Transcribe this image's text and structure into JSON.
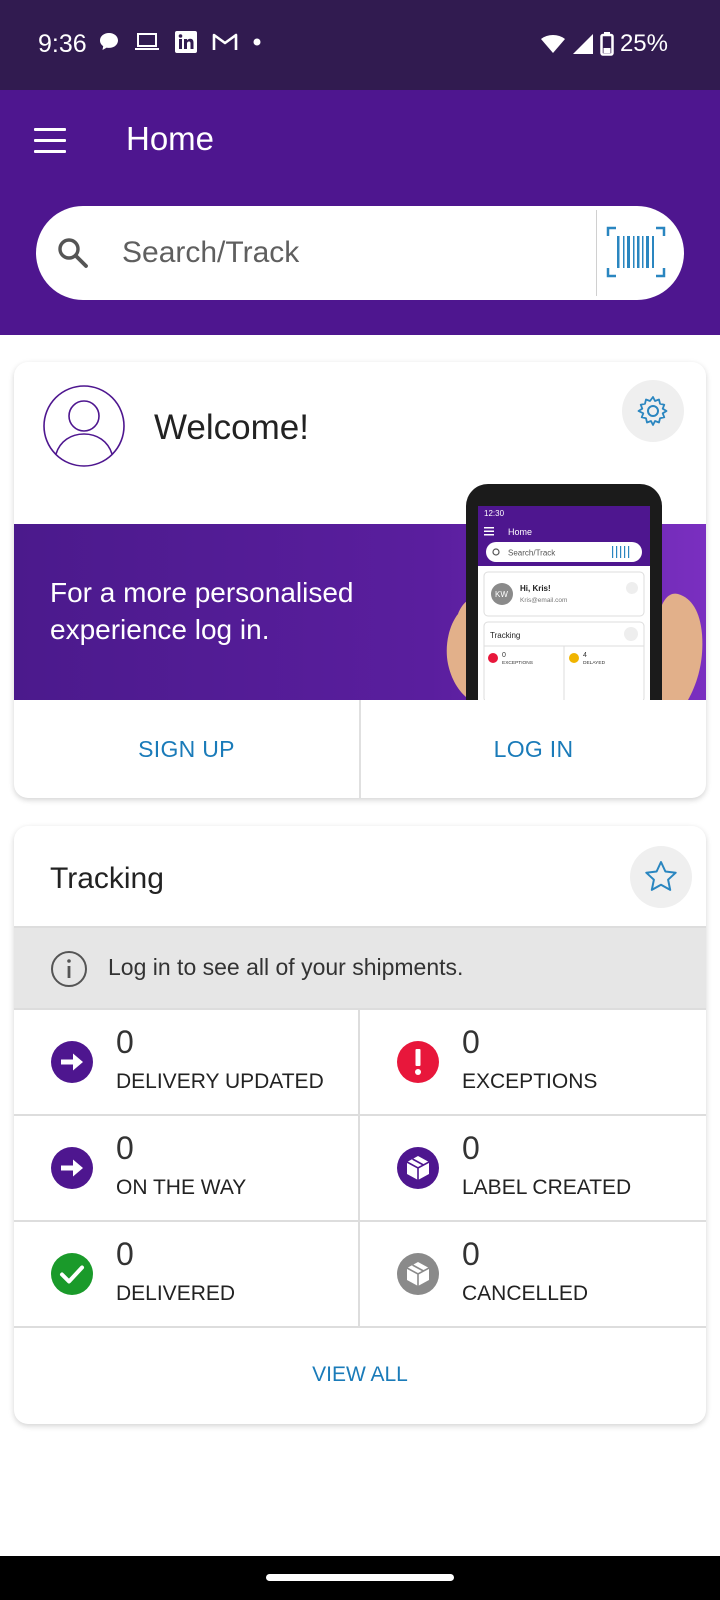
{
  "status_bar": {
    "time": "9:36",
    "battery": "25%",
    "icons": [
      "chat-icon",
      "laptop-icon",
      "linkedin-icon",
      "gmail-icon",
      "dot-icon",
      "wifi-icon",
      "signal-icon",
      "battery-icon"
    ]
  },
  "app_bar": {
    "title": "Home",
    "search_placeholder": "Search/Track"
  },
  "welcome": {
    "title": "Welcome!",
    "promo_text": "For a more personalised experience log in.",
    "sign_up_label": "SIGN UP",
    "log_in_label": "LOG IN",
    "phone_mock": {
      "time": "12:30",
      "title": "Home",
      "search": "Search/Track",
      "avatar": "KW",
      "greeting": "Hi, Kris!",
      "email": "Kris@email.com",
      "tracking": "Tracking",
      "exceptions_count": "0",
      "exceptions_label": "EXCEPTIONS",
      "delayed_count": "4",
      "delayed_label": "DELAYED"
    }
  },
  "tracking": {
    "title": "Tracking",
    "info_message": "Log in to see all of your shipments.",
    "items": [
      {
        "count": "0",
        "label": "DELIVERY UPDATED",
        "icon": "arrow-right-icon",
        "color": "#4e168f"
      },
      {
        "count": "0",
        "label": "EXCEPTIONS",
        "icon": "exclamation-icon",
        "color": "#e8173b"
      },
      {
        "count": "0",
        "label": "ON THE WAY",
        "icon": "arrow-right-icon",
        "color": "#4e168f"
      },
      {
        "count": "0",
        "label": "LABEL CREATED",
        "icon": "package-icon",
        "color": "#4e168f"
      },
      {
        "count": "0",
        "label": "DELIVERED",
        "icon": "check-icon",
        "color": "#1a9a2a"
      },
      {
        "count": "0",
        "label": "CANCELLED",
        "icon": "package-icon",
        "color": "#8a8a8a"
      }
    ],
    "view_all_label": "VIEW ALL"
  },
  "colors": {
    "brand_purple": "#4e168f",
    "status_bar": "#311b50",
    "link_blue": "#1a7bb9"
  }
}
